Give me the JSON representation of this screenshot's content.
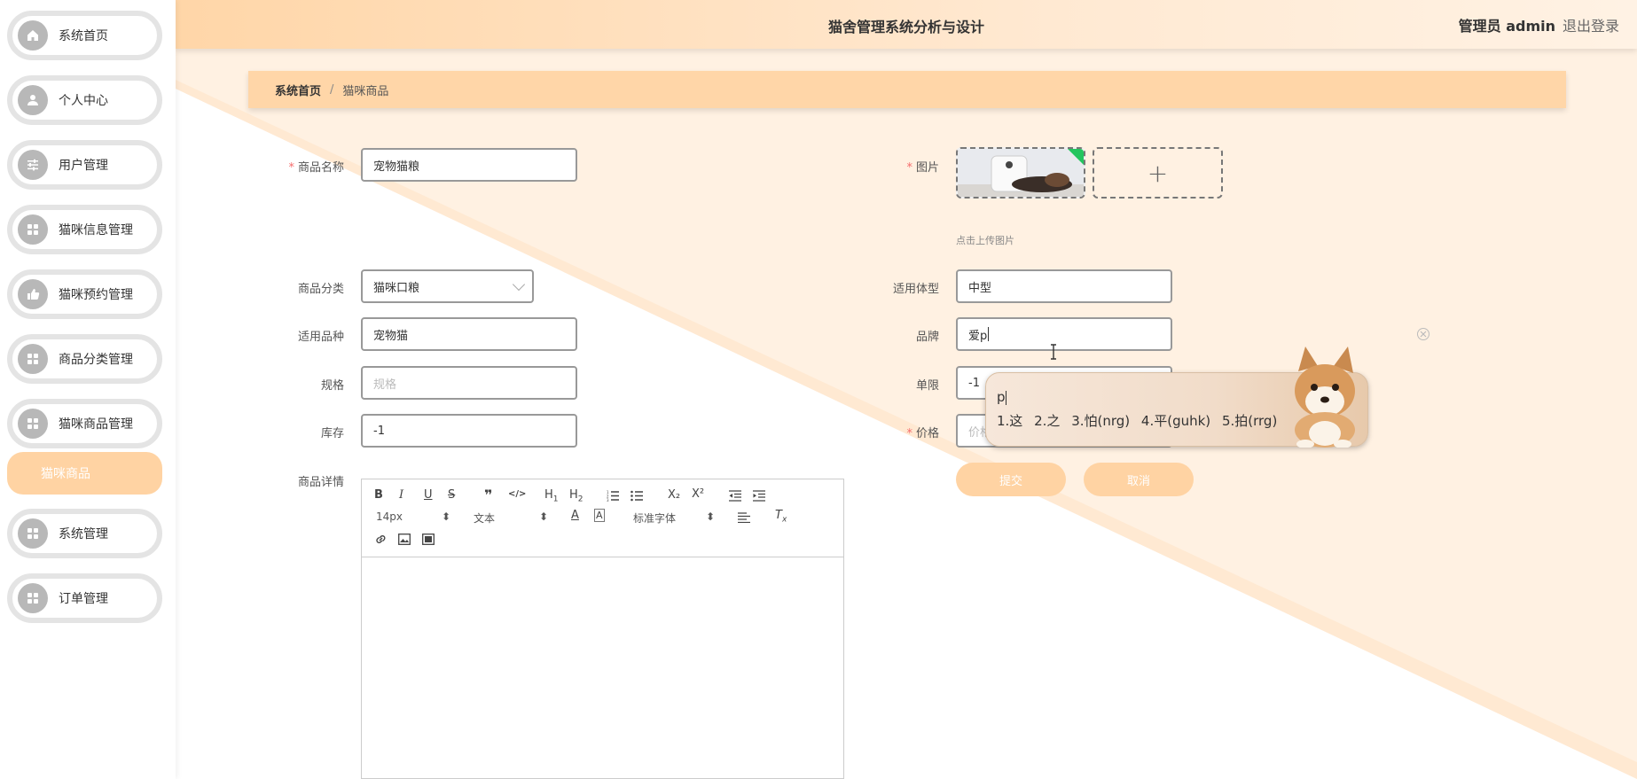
{
  "app": {
    "title": "猫舍管理系统分析与设计",
    "admin_label": "管理员 admin",
    "logout_label": "退出登录"
  },
  "sidebar": {
    "items": [
      {
        "label": "系统首页",
        "icon": "home-icon"
      },
      {
        "label": "个人中心",
        "icon": "user-icon"
      },
      {
        "label": "用户管理",
        "icon": "sliders-icon"
      },
      {
        "label": "猫咪信息管理",
        "icon": "grid-icon"
      },
      {
        "label": "猫咪预约管理",
        "icon": "thumb-icon"
      },
      {
        "label": "商品分类管理",
        "icon": "grid-icon"
      },
      {
        "label": "猫咪商品管理",
        "icon": "grid-icon"
      },
      {
        "label": "系统管理",
        "icon": "grid-icon"
      },
      {
        "label": "订单管理",
        "icon": "grid-icon"
      }
    ],
    "active_sub": "猫咪商品"
  },
  "breadcrumb": {
    "home": "系统首页",
    "sep": "/",
    "current": "猫咪商品"
  },
  "form": {
    "name_label": "商品名称",
    "name_value": "宠物猫粮",
    "image_label": "图片",
    "upload_tip": "点击上传图片",
    "upload_plus": "+",
    "category_label": "商品分类",
    "category_value": "猫咪口粮",
    "size_label": "适用体型",
    "size_value": "中型",
    "breed_label": "适用品种",
    "breed_value": "宠物猫",
    "brand_label": "品牌",
    "brand_value": "爱p",
    "spec_label": "规格",
    "spec_placeholder": "规格",
    "limit_label": "单限",
    "limit_value": "-1",
    "stock_label": "库存",
    "stock_value": "-1",
    "price_label": "价格",
    "price_placeholder": "价格",
    "detail_label": "商品详情",
    "submit_label": "提交",
    "cancel_label": "取消",
    "required_mark": "*"
  },
  "editor": {
    "font_size": "14px",
    "block": "文本",
    "font": "标准字体",
    "tools_row1": [
      "B",
      "I",
      "U",
      "S",
      "❞",
      "</>",
      "H1",
      "H2",
      "ol",
      "ul",
      "X₂",
      "X²",
      "outdent",
      "indent"
    ],
    "tools_row2": [
      "A",
      "A-bg",
      "align",
      "Tx"
    ],
    "tools_row3": [
      "link",
      "image",
      "video"
    ]
  },
  "ime": {
    "typed": "p",
    "candidates": [
      "1.这",
      "2.之",
      "3.怕(nrg)",
      "4.平(guhk)",
      "5.拍(rrg)"
    ]
  }
}
